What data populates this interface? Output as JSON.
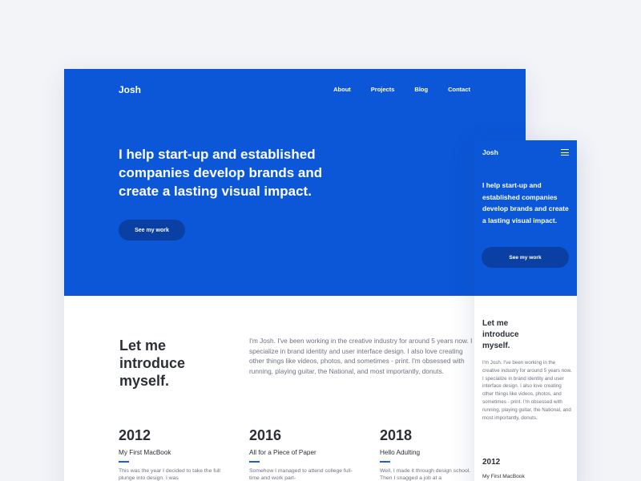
{
  "desktop": {
    "logo": "Josh",
    "nav": [
      "About",
      "Projects",
      "Blog",
      "Contact"
    ],
    "headline": "I help start-up and established companies develop brands and create a lasting visual impact.",
    "cta": "See my work",
    "intro_title": "Let me introduce myself.",
    "intro_text": "I'm Josh. I've been working in the creative industry for around 5 years now. I specialize in brand identity and user interface design. I also love creating other things like videos, photos, and sometimes - print. I'm obsessed with running, playing guitar, the National, and most importantly, donuts.",
    "timeline": [
      {
        "year": "2012",
        "title": "My First MacBook",
        "text": "This was the year I decided to take the full plunge into design. I was"
      },
      {
        "year": "2016",
        "title": "All for a Piece of Paper",
        "text": "Somehow I managed to attend college full-time and work part-"
      },
      {
        "year": "2018",
        "title": "Hello Adulting",
        "text": "Well, I made it through design school. Then I snagged a job at a"
      }
    ],
    "accent_color": "#0b57d8"
  },
  "mobile": {
    "logo": "Josh",
    "menu_icon": "hamburger-menu-icon",
    "headline": "I help start-up and established companies develop brands and create a lasting visual impact.",
    "cta": "See my work",
    "intro_title": "Let me introduce myself.",
    "intro_text": "I'm Josh. I've been working in the creative industry for around 5 years now. I specialize in brand identity and user interface design. I also love creating other things like videos, photos, and sometimes - print. I'm obsessed with running, playing guitar, the National, and most importantly, donuts.",
    "year": "2012",
    "event": "My First MacBook"
  }
}
